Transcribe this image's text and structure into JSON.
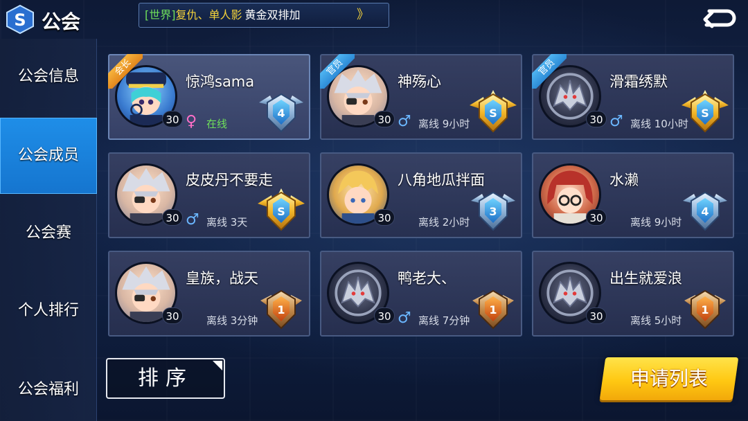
{
  "header": {
    "title": "公会",
    "broadcast": {
      "channel": "[世界]",
      "sender": "复仇、单人影",
      "message": "黄金双排加",
      "arrow": "》"
    }
  },
  "sidebar": {
    "items": [
      {
        "label": "公会信息",
        "active": false
      },
      {
        "label": "公会成员",
        "active": true
      },
      {
        "label": "公会赛",
        "active": false
      },
      {
        "label": "个人排行",
        "active": false
      },
      {
        "label": "公会福利",
        "active": false
      }
    ]
  },
  "members": [
    {
      "name": "惊鸿sama",
      "level": "30",
      "gender": "♀",
      "status": "在线",
      "role": "会长",
      "rank_number": "4",
      "rank_tier": "diamond",
      "avatar": "captain-girl-avatar"
    },
    {
      "name": "神殇心",
      "level": "30",
      "gender": "♂",
      "status": "离线 9小时",
      "role": "官员",
      "rank_number": "S",
      "rank_tier": "star-gold",
      "avatar": "white-hair-eyepatch-avatar"
    },
    {
      "name": "滑霜绣默",
      "level": "30",
      "gender": "♂",
      "status": "离线 10小时",
      "role": "官员",
      "rank_number": "S",
      "rank_tier": "star-gold",
      "avatar": "wolf-emblem-avatar"
    },
    {
      "name": "皮皮丹不要走",
      "level": "30",
      "gender": "♂",
      "status": "离线 3天",
      "role": "",
      "rank_number": "S",
      "rank_tier": "star-gold",
      "avatar": "white-hair-eyepatch-avatar"
    },
    {
      "name": "八角地瓜拌面",
      "level": "30",
      "gender": "",
      "status": "离线 2小时",
      "role": "",
      "rank_number": "3",
      "rank_tier": "diamond",
      "avatar": "blonde-boy-avatar"
    },
    {
      "name": "水濑",
      "level": "30",
      "gender": "",
      "status": "离线 9小时",
      "role": "",
      "rank_number": "4",
      "rank_tier": "diamond",
      "avatar": "red-hair-glasses-avatar"
    },
    {
      "name": "皇族，战天",
      "level": "30",
      "gender": "",
      "status": "离线 3分钟",
      "role": "",
      "rank_number": "1",
      "rank_tier": "bronze",
      "avatar": "white-hair-eyepatch-avatar"
    },
    {
      "name": "鸭老大、",
      "level": "30",
      "gender": "♂",
      "status": "离线 7分钟",
      "role": "",
      "rank_number": "1",
      "rank_tier": "bronze",
      "avatar": "wolf-emblem-avatar"
    },
    {
      "name": "出生就爱浪",
      "level": "30",
      "gender": "",
      "status": "离线 5小时",
      "role": "",
      "rank_number": "1",
      "rank_tier": "bronze",
      "avatar": "wolf-emblem-avatar"
    }
  ],
  "buttons": {
    "sort": "排序",
    "apply_list": "申请列表"
  },
  "colors": {
    "accent_blue": "#1f8ee8",
    "online_green": "#6fe05a",
    "apply_yellow": "#ffc812",
    "male_blue": "#6bb7ff",
    "female_pink": "#ff6fc8"
  }
}
